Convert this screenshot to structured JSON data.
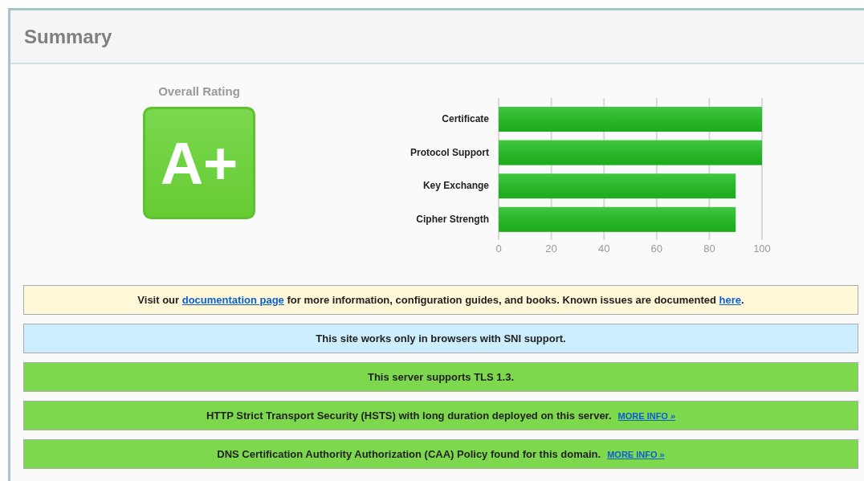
{
  "header": {
    "title": "Summary"
  },
  "rating": {
    "label": "Overall Rating",
    "grade": "A+"
  },
  "chart": {
    "chart_data": {
      "type": "bar",
      "orientation": "horizontal",
      "categories": [
        "Certificate",
        "Protocol Support",
        "Key Exchange",
        "Cipher Strength"
      ],
      "series": [
        {
          "color": "#1fbf1f",
          "values": [
            100,
            100,
            90,
            90
          ]
        }
      ],
      "xlim": [
        0,
        100
      ],
      "xticks": [
        0,
        20,
        40,
        60,
        80,
        100
      ],
      "grid": true
    }
  },
  "notices": [
    {
      "kind": "warning",
      "parts": [
        {
          "text": "Visit our ",
          "link": false
        },
        {
          "text": "documentation page",
          "link": true
        },
        {
          "text": " for more information, configuration guides, and books. Known issues are documented ",
          "link": false
        },
        {
          "text": "here",
          "link": true
        },
        {
          "text": ".",
          "link": false
        }
      ]
    },
    {
      "kind": "info",
      "parts": [
        {
          "text": "This site works only in browsers with SNI support.",
          "link": false
        }
      ]
    },
    {
      "kind": "success",
      "parts": [
        {
          "text": "This server supports TLS 1.3.",
          "link": false
        }
      ]
    },
    {
      "kind": "success",
      "parts": [
        {
          "text": "HTTP Strict Transport Security (HSTS) with long duration deployed on this server.",
          "link": false
        }
      ],
      "more": "MORE INFO »"
    },
    {
      "kind": "success",
      "parts": [
        {
          "text": "DNS Certification Authority Authorization (CAA) Policy found for this domain.",
          "link": false
        }
      ],
      "more": "MORE INFO »"
    }
  ]
}
